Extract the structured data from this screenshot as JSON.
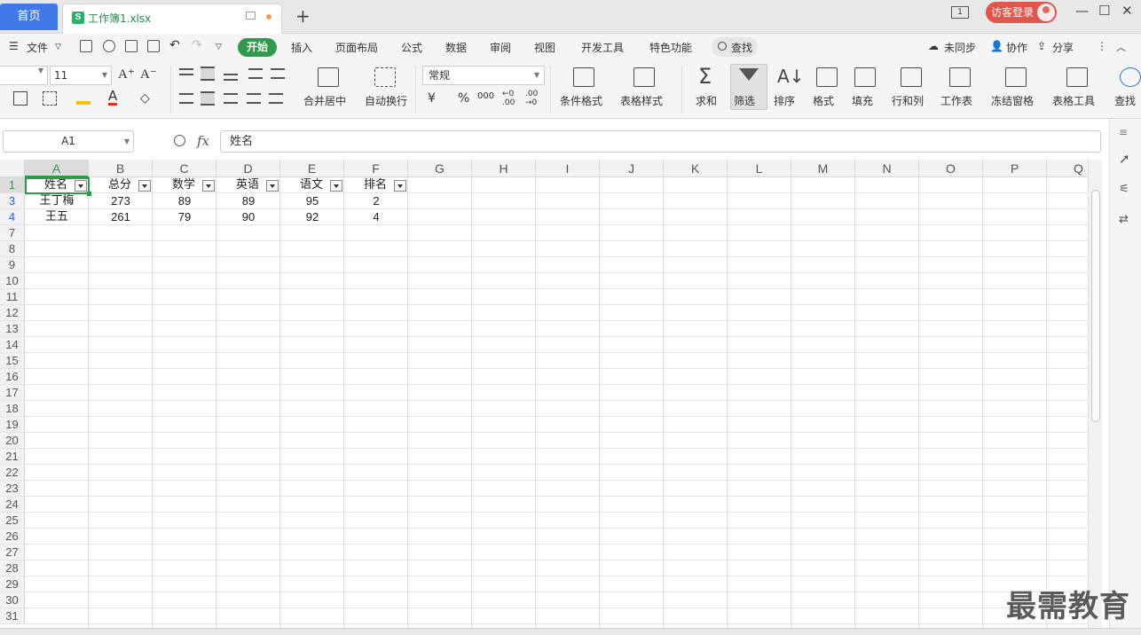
{
  "tabs": {
    "home": "首页",
    "file_name": "工作簿1.xlsx",
    "file_icon": "S",
    "add": "+"
  },
  "titlebar": {
    "layout_icon_label": "1",
    "login": "访客登录",
    "min": "—",
    "max": "☐",
    "close": "✕"
  },
  "menu": {
    "file": "文件",
    "items": [
      "开始",
      "插入",
      "页面布局",
      "公式",
      "数据",
      "审阅",
      "视图",
      "开发工具",
      "特色功能"
    ],
    "search": "查找",
    "right": [
      "未同步",
      "协作",
      "分享"
    ]
  },
  "ribbon": {
    "font_size": "11",
    "number_format": "常规",
    "labels": [
      "合并居中",
      "自动换行",
      "条件格式",
      "表格样式",
      "求和",
      "筛选",
      "排序",
      "格式",
      "填充",
      "行和列",
      "工作表",
      "冻结窗格",
      "表格工具",
      "查找"
    ],
    "currency": "¥",
    "percent": "%",
    "thousands": "000",
    "dec_inc": "←0 .00",
    "dec_dec": ".00 →0"
  },
  "formula_bar": {
    "cell_ref": "A1",
    "fx": "fx",
    "value": "姓名"
  },
  "sheet": {
    "columns": [
      "A",
      "B",
      "C",
      "D",
      "E",
      "F",
      "G",
      "H",
      "I",
      "J",
      "K",
      "L",
      "M",
      "N",
      "O",
      "P",
      "Q"
    ],
    "row_numbers": [
      "1",
      "3",
      "4",
      "7",
      "8",
      "9",
      "10",
      "11",
      "12",
      "13",
      "14",
      "15",
      "16",
      "17",
      "18",
      "19",
      "20",
      "21",
      "22",
      "23",
      "24",
      "25",
      "26",
      "27",
      "28",
      "29",
      "30",
      "31"
    ],
    "headers": [
      "姓名",
      "总分",
      "数学",
      "英语",
      "语文",
      "排名"
    ],
    "rows": [
      [
        "王丁梅",
        "273",
        "89",
        "89",
        "95",
        "2"
      ],
      [
        "王五",
        "261",
        "79",
        "90",
        "92",
        "4"
      ]
    ]
  },
  "watermark": "最需教育",
  "colors": {
    "accent_green": "#2f9a4b",
    "home_tab_blue": "#3f7ae8",
    "login_red": "#e0574e",
    "row_blue": "#2a5fcf"
  }
}
